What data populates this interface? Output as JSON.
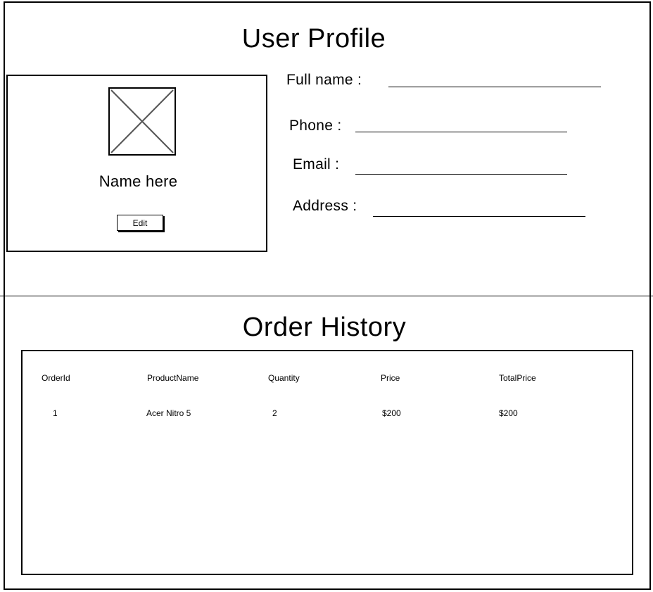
{
  "profile": {
    "title": "User Profile",
    "display_name": "Name here",
    "edit_label": "Edit",
    "fields": [
      {
        "label": "Full name :",
        "value": ""
      },
      {
        "label": "Phone :",
        "value": ""
      },
      {
        "label": "Email :",
        "value": ""
      },
      {
        "label": "Address :",
        "value": ""
      }
    ]
  },
  "orders": {
    "title": "Order History",
    "columns": [
      "OrderId",
      "ProductName",
      "Quantity",
      "Price",
      "TotalPrice"
    ],
    "rows": [
      [
        "1",
        "Acer Nitro 5",
        "2",
        "$200",
        "$200"
      ]
    ]
  }
}
